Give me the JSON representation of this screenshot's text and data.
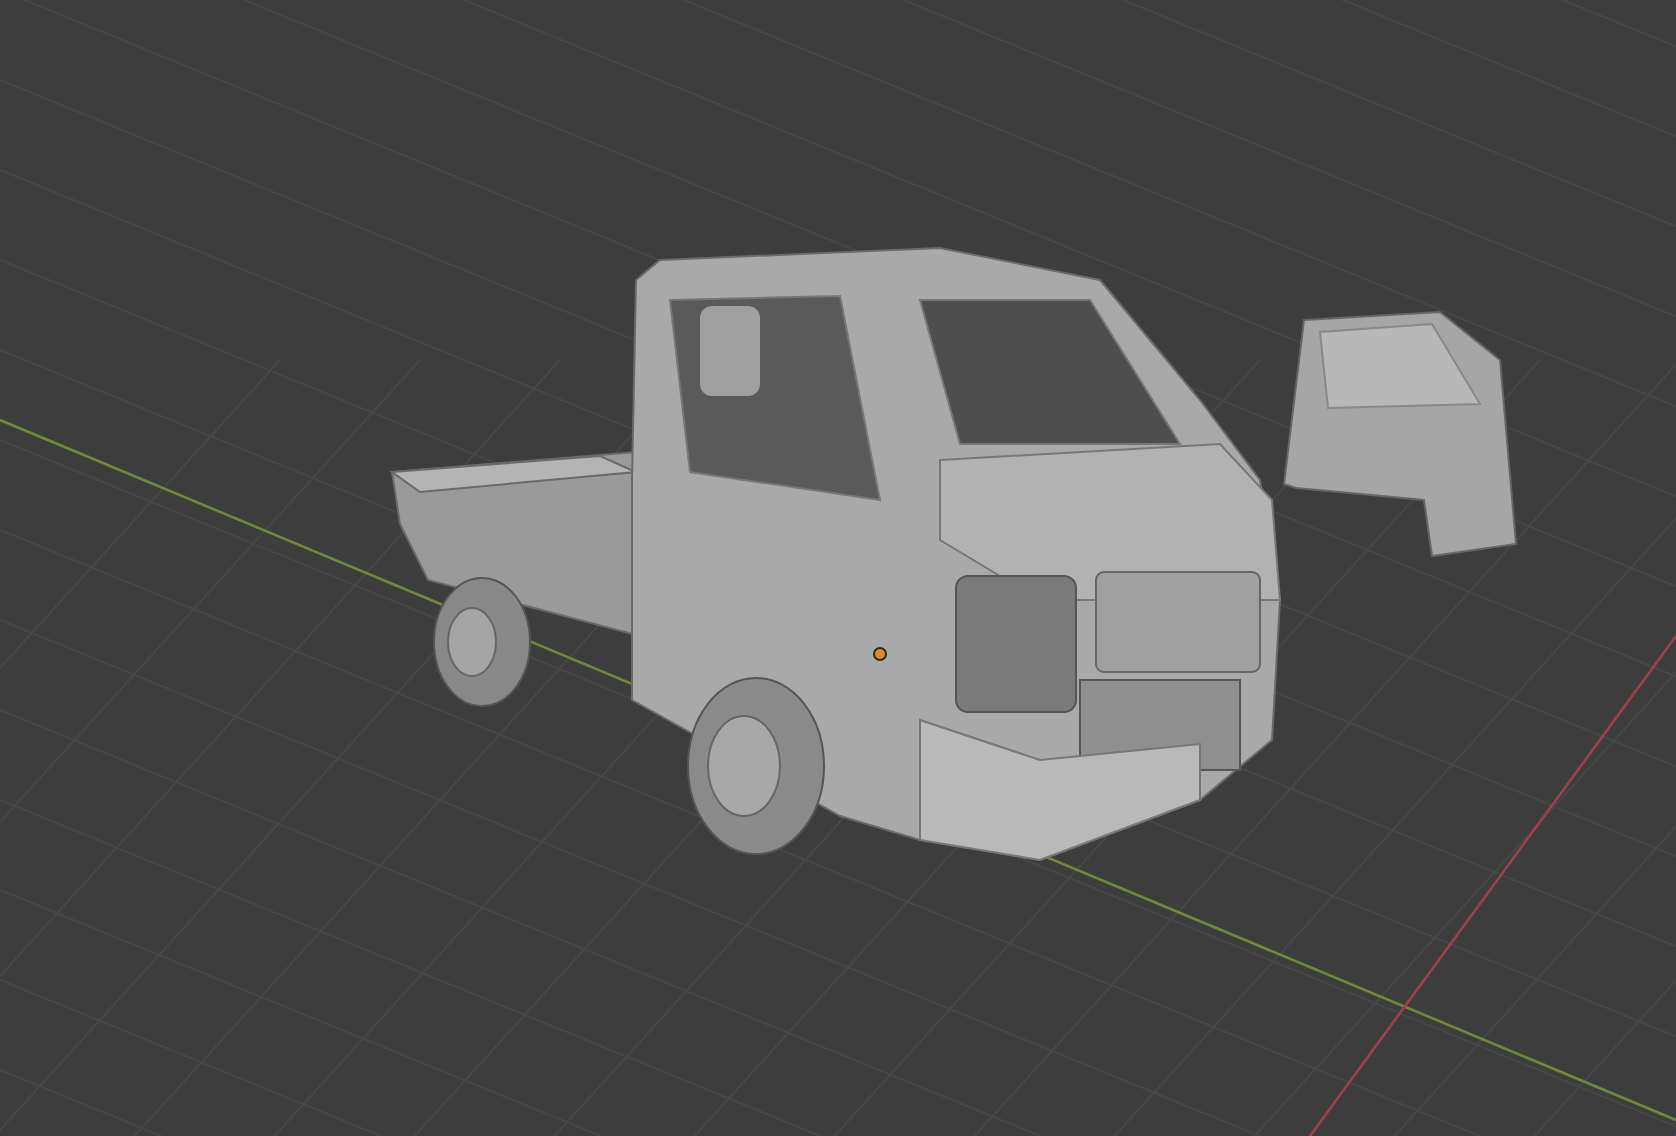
{
  "viewport": {
    "show_grid": true,
    "show_axes": true,
    "show_origin": true
  }
}
